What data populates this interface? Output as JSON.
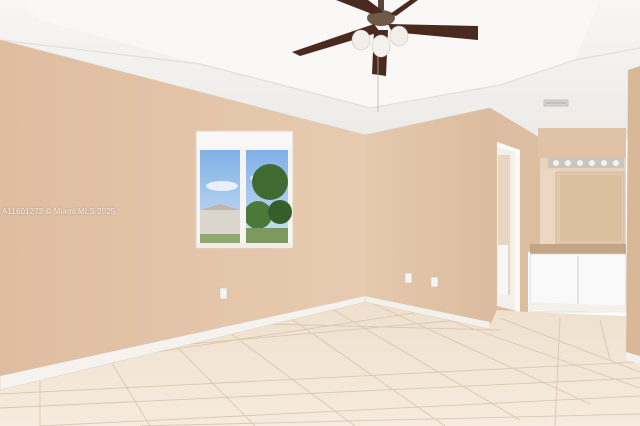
{
  "watermark": {
    "text": "A11601272 © Miami MLS 2025"
  },
  "colors": {
    "wall": "#e5c6aa",
    "wall_shadow": "#d9b796",
    "ceiling": "#f3f1ee",
    "floor_tile": "#f2e3d1",
    "grout": "#d9c6b0",
    "baseboard": "#f4f1ec",
    "fan_blade": "#4a2a1f",
    "sky": "#9fc3ea",
    "foliage": "#3f6b32",
    "vanity": "#fbfbfb"
  },
  "icons": {
    "fan": "ceiling-fan-icon",
    "window": "window-icon",
    "outlet": "outlet-icon",
    "vent": "air-vent-icon"
  }
}
